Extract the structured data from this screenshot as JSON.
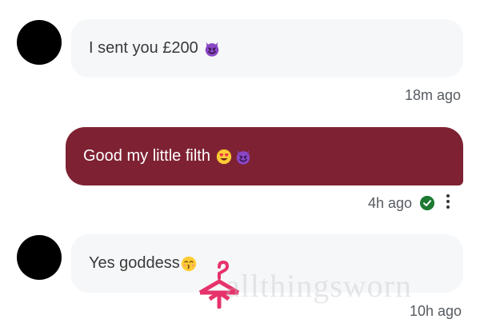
{
  "messages": [
    {
      "direction": "incoming",
      "text": "I sent you £200",
      "emoji": "smiling-devil",
      "time": "18m ago"
    },
    {
      "direction": "outgoing",
      "text": "Good my little filth",
      "emoji": [
        "heart-eyes",
        "smiling-devil"
      ],
      "time": "4h ago",
      "status": "delivered"
    },
    {
      "direction": "incoming",
      "text": "Yes goddess",
      "emoji": "kissing-face",
      "time": "10h ago"
    }
  ],
  "watermark": {
    "text": "allthingsworn"
  },
  "colors": {
    "incoming_bubble": "#f6f7f9",
    "outgoing_bubble": "#7e2233",
    "status_check": "#1e7a32",
    "watermark_pink": "#e6336b"
  }
}
